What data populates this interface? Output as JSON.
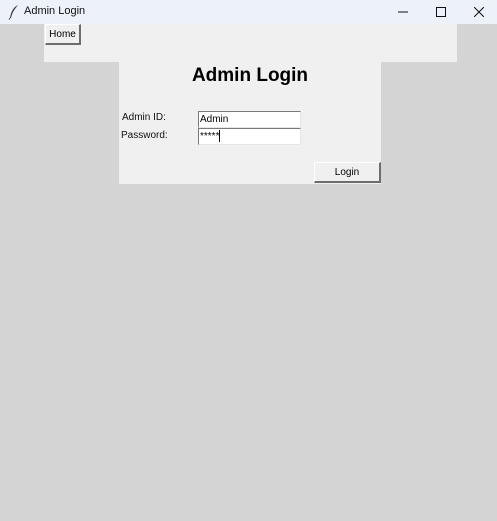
{
  "window": {
    "title": "Admin Login",
    "app_icon": "feather-icon",
    "controls": {
      "minimize": "minimize-icon",
      "maximize": "maximize-icon",
      "close": "close-icon"
    }
  },
  "nav": {
    "home_label": "Home"
  },
  "login": {
    "heading": "Admin Login",
    "admin_id_label": "Admin ID:",
    "admin_id_value": "Admin",
    "password_label": "Password:",
    "password_value": "*****",
    "login_label": "Login"
  },
  "colors": {
    "background": "#d4d4d4",
    "frame": "#f0f0f0",
    "titlebar": "#ecf1fa"
  }
}
